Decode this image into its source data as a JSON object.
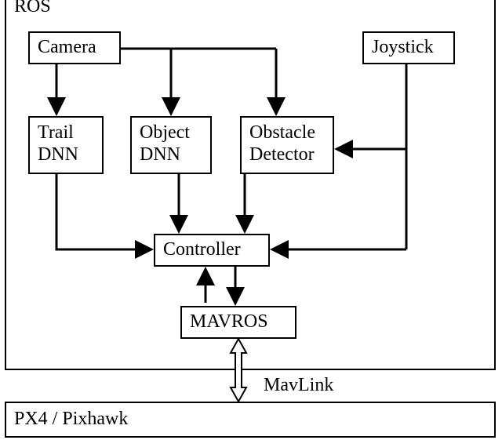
{
  "labels": {
    "ros": "ROS",
    "camera": "Camera",
    "joystick": "Joystick",
    "trail_dnn_l1": "Trail",
    "trail_dnn_l2": "DNN",
    "object_dnn_l1": "Object",
    "object_dnn_l2": "DNN",
    "obstacle_l1": "Obstacle",
    "obstacle_l2": "Detector",
    "controller": "Controller",
    "mavros": "MAVROS",
    "mavlink": "MavLink",
    "px4": "PX4 / Pixhawk"
  },
  "chart_data": {
    "type": "diagram",
    "title": "MAV software architecture",
    "containers": [
      {
        "id": "ros",
        "label": "ROS",
        "children": [
          "camera",
          "joystick",
          "trail_dnn",
          "object_dnn",
          "obstacle_detector",
          "controller",
          "mavros"
        ]
      },
      {
        "id": "px4",
        "label": "PX4 / Pixhawk"
      }
    ],
    "nodes": [
      {
        "id": "camera",
        "label": "Camera"
      },
      {
        "id": "joystick",
        "label": "Joystick"
      },
      {
        "id": "trail_dnn",
        "label": "Trail DNN"
      },
      {
        "id": "object_dnn",
        "label": "Object DNN"
      },
      {
        "id": "obstacle_detector",
        "label": "Obstacle Detector"
      },
      {
        "id": "controller",
        "label": "Controller"
      },
      {
        "id": "mavros",
        "label": "MAVROS"
      }
    ],
    "edges": [
      {
        "from": "camera",
        "to": "trail_dnn",
        "directed": true
      },
      {
        "from": "camera",
        "to": "object_dnn",
        "directed": true
      },
      {
        "from": "camera",
        "to": "obstacle_detector",
        "directed": true
      },
      {
        "from": "trail_dnn",
        "to": "controller",
        "directed": true
      },
      {
        "from": "object_dnn",
        "to": "controller",
        "directed": true
      },
      {
        "from": "obstacle_detector",
        "to": "controller",
        "directed": true
      },
      {
        "from": "joystick",
        "to": "controller",
        "directed": true
      },
      {
        "from": "joystick",
        "to": "obstacle_detector",
        "directed": true
      },
      {
        "from": "controller",
        "to": "mavros",
        "bidirectional": true
      },
      {
        "from": "mavros",
        "to": "px4",
        "bidirectional": true,
        "label": "MavLink",
        "protocol": true
      }
    ]
  }
}
